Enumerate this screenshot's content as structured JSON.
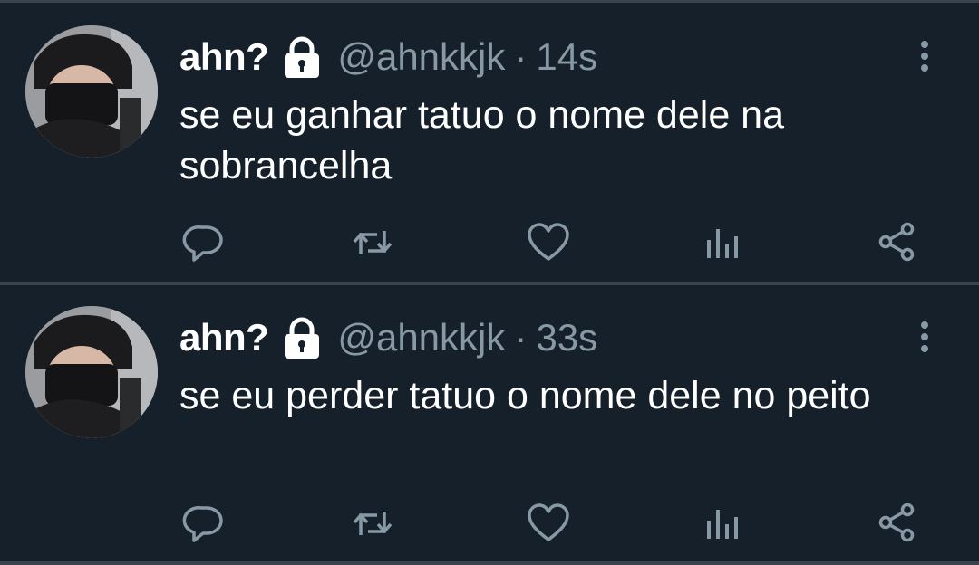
{
  "tweets": [
    {
      "name": "ahn?",
      "handle": "@ahnkkjk",
      "separator": "·",
      "time": "14s",
      "text": "se eu ganhar tatuo o nome dele na sobrancelha"
    },
    {
      "name": "ahn?",
      "handle": "@ahnkkjk",
      "separator": "·",
      "time": "33s",
      "text": "se eu perder tatuo o nome dele no peito"
    }
  ],
  "icons": {
    "lock": "lock-icon",
    "more": "more-vertical-icon",
    "reply": "reply-icon",
    "retweet": "retweet-icon",
    "like": "heart-icon",
    "analytics": "analytics-icon",
    "share": "share-icon"
  },
  "colors": {
    "background": "#15202b",
    "divider": "#38444d",
    "secondary_text": "#8899a6",
    "primary_text": "#ffffff"
  }
}
